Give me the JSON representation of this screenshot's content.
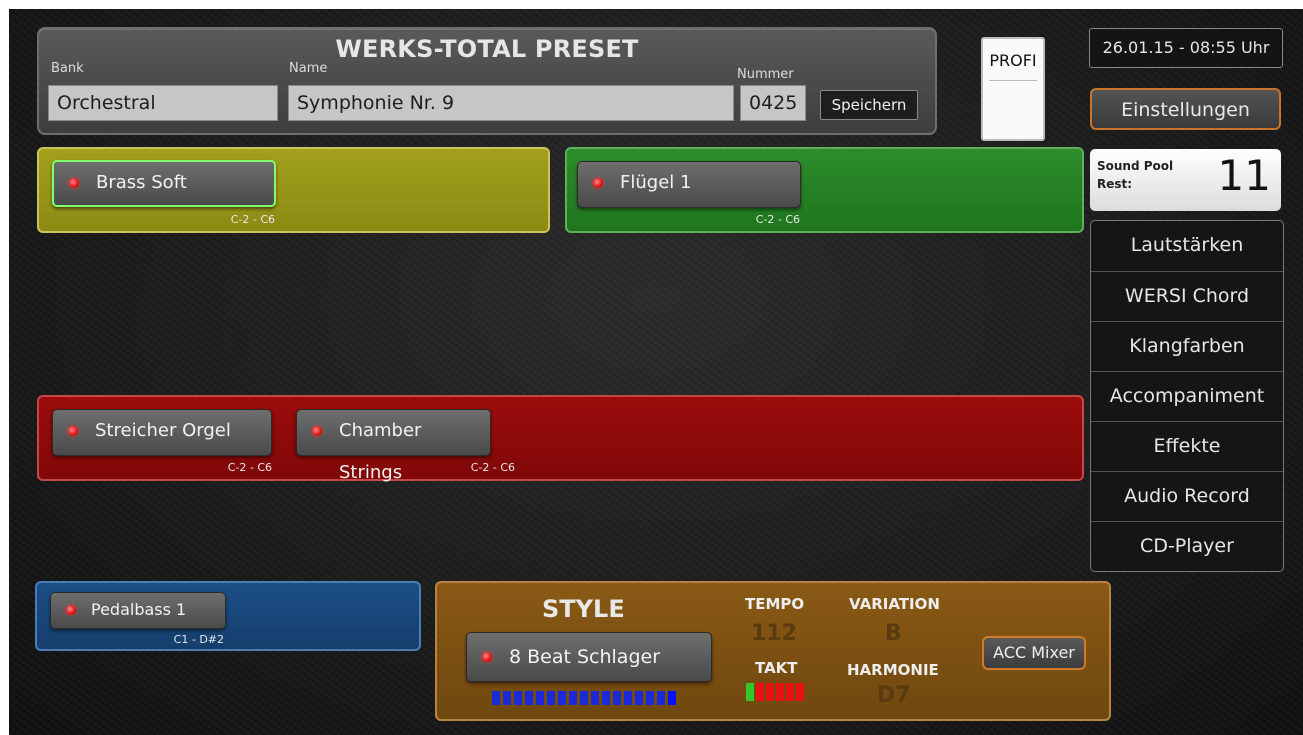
{
  "preset": {
    "title": "WERKS-TOTAL PRESET",
    "bank_label": "Bank",
    "bank_value": "Orchestral",
    "name_label": "Name",
    "name_value": "Symphonie Nr. 9",
    "number_label": "Nummer",
    "number_value": "0425",
    "save_label": "Speichern"
  },
  "profi": {
    "label": "PROFI"
  },
  "datetime": "26.01.15 - 08:55 Uhr",
  "settings_label": "Einstellungen",
  "sound_pool": {
    "label_line1": "Sound Pool",
    "label_line2": "Rest:",
    "value": "11"
  },
  "menu": [
    {
      "label": "Lautstärken"
    },
    {
      "label": "WERSI Chord"
    },
    {
      "label": "Klangfarben"
    },
    {
      "label": "Accompaniment"
    },
    {
      "label": "Effekte"
    },
    {
      "label": "Audio Record"
    },
    {
      "label": "CD-Player"
    }
  ],
  "zones": {
    "upper_left": {
      "voice": "Brass Soft",
      "range": "C-2 - C6",
      "color": "#a2a01c"
    },
    "upper_right": {
      "voice": "Flügel 1",
      "range": "C-2 - C6",
      "color": "#2c8c2a"
    },
    "lower": [
      {
        "voice": "Streicher Orgel",
        "range": "C-2 - C6"
      },
      {
        "voice": "Chamber Strings",
        "range": "C-2 - C6"
      }
    ],
    "lower_color": "#9c0c0c",
    "pedal": {
      "voice": "Pedalbass 1",
      "range": "C1 - D#2",
      "color": "#1c4f88"
    }
  },
  "style": {
    "title": "STYLE",
    "name": "8 Beat Schlager",
    "tempo_label": "TEMPO",
    "tempo_value": "112",
    "variation_label": "VARIATION",
    "variation_value": "B",
    "takt_label": "TAKT",
    "harmonie_label": "HARMONIE",
    "harmonie_value": "D7",
    "acc_mixer_label": "ACC Mixer",
    "color": "#8a5a16"
  }
}
